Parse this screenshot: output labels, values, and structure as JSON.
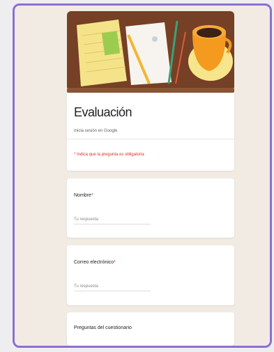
{
  "form": {
    "title": "Evaluación",
    "account": "Inicia sesión en Google",
    "required_note": "* Indica que la pregunta es obligatoria"
  },
  "questions": [
    {
      "label": "Nombre",
      "required_mark": "*",
      "placeholder": "Tu respuesta"
    },
    {
      "label": "Correo electrónico",
      "required_mark": "*",
      "placeholder": "Tu respuesta"
    },
    {
      "label": "Preguntas del cuestionario"
    }
  ],
  "colors": {
    "accent": "#8b5434",
    "device_border": "#8d6fd0",
    "background": "#f2ebe4",
    "required": "#d93025"
  },
  "icons": [
    "notepad-icon",
    "coffee-cup-icon",
    "pencil-icon"
  ]
}
